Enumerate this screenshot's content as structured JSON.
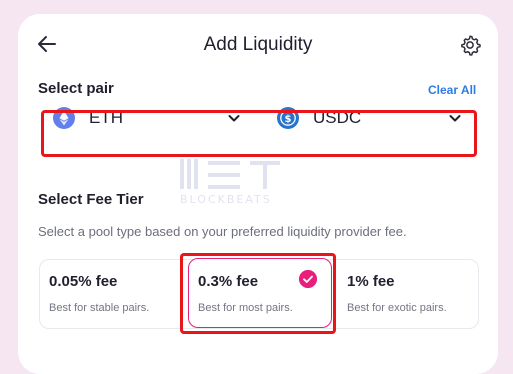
{
  "header": {
    "title": "Add Liquidity"
  },
  "pair_section": {
    "label": "Select pair",
    "clear_label": "Clear All",
    "token_a": {
      "symbol": "ETH",
      "icon": "eth-icon",
      "color": "#627eea"
    },
    "token_b": {
      "symbol": "USDC",
      "icon": "usdc-icon",
      "color": "#2775ca"
    }
  },
  "fee_section": {
    "label": "Select Fee Tier",
    "description": "Select a pool type based on your preferred liquidity provider fee.",
    "tiers": [
      {
        "fee": "0.05% fee",
        "note": "Best for stable pairs.",
        "selected": false
      },
      {
        "fee": "0.3% fee",
        "note": "Best for most pairs.",
        "selected": true
      },
      {
        "fee": "1% fee",
        "note": "Best for exotic pairs.",
        "selected": false
      }
    ]
  },
  "watermark": {
    "text": "BLOCKBEATS"
  },
  "colors": {
    "accent": "#e91e7b",
    "link": "#2d7be5",
    "annotation": "#e8161b",
    "background": "#f6e6f1"
  }
}
